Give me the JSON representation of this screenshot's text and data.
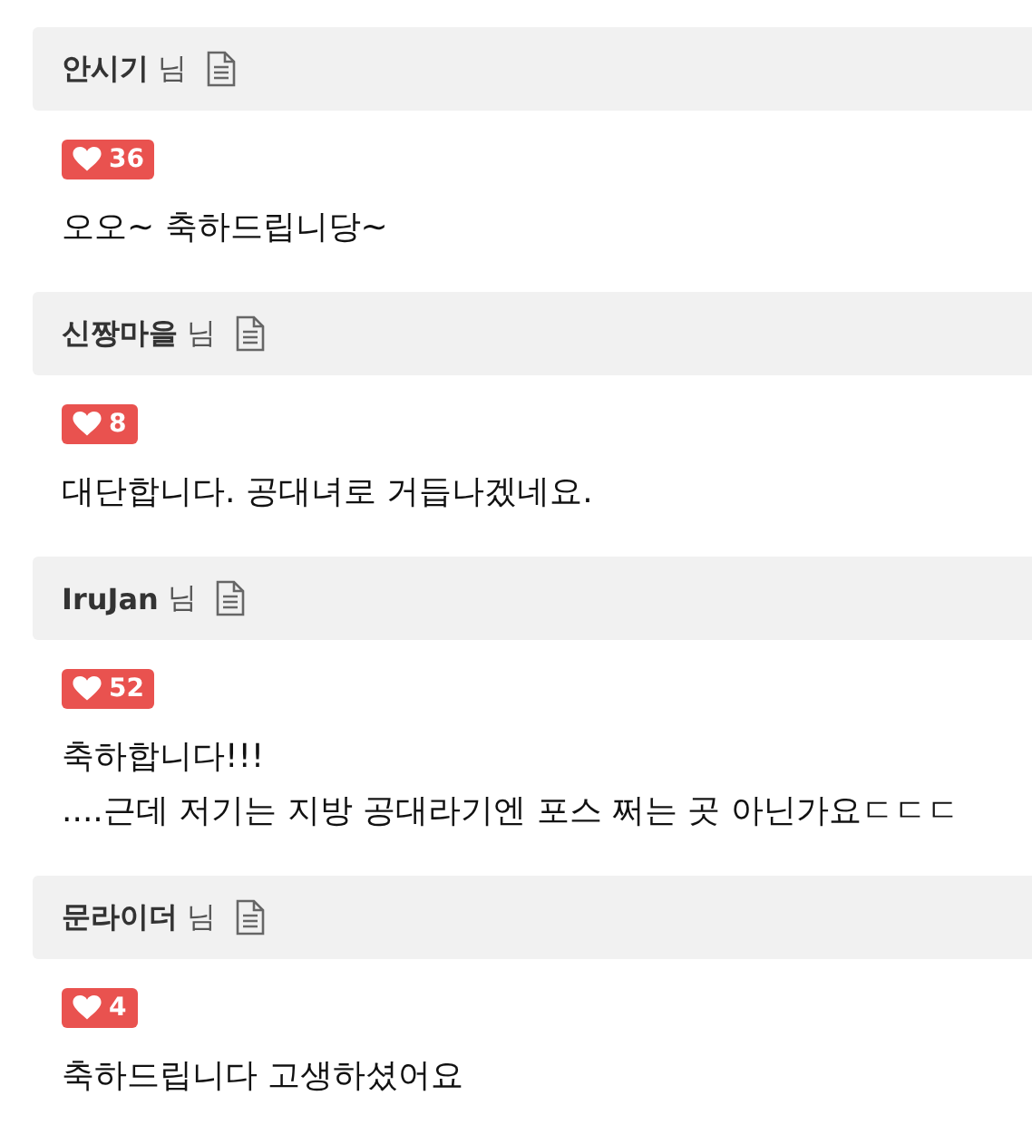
{
  "comments": [
    {
      "author": "안시기",
      "suffix": "님",
      "likes": "36",
      "text": "오오~ 축하드립니당~"
    },
    {
      "author": "신짱마을",
      "suffix": "님",
      "likes": "8",
      "text": "대단합니다. 공대녀로 거듭나겠네요."
    },
    {
      "author": "IruJan",
      "suffix": "님",
      "likes": "52",
      "text": "축하합니다!!!\n....근데 저기는 지방 공대라기엔 포스 쩌는 곳 아닌가요ㄷㄷㄷ"
    },
    {
      "author": "문라이더",
      "suffix": "님",
      "likes": "4",
      "text": "축하드립니다 고생하셨어요"
    }
  ]
}
